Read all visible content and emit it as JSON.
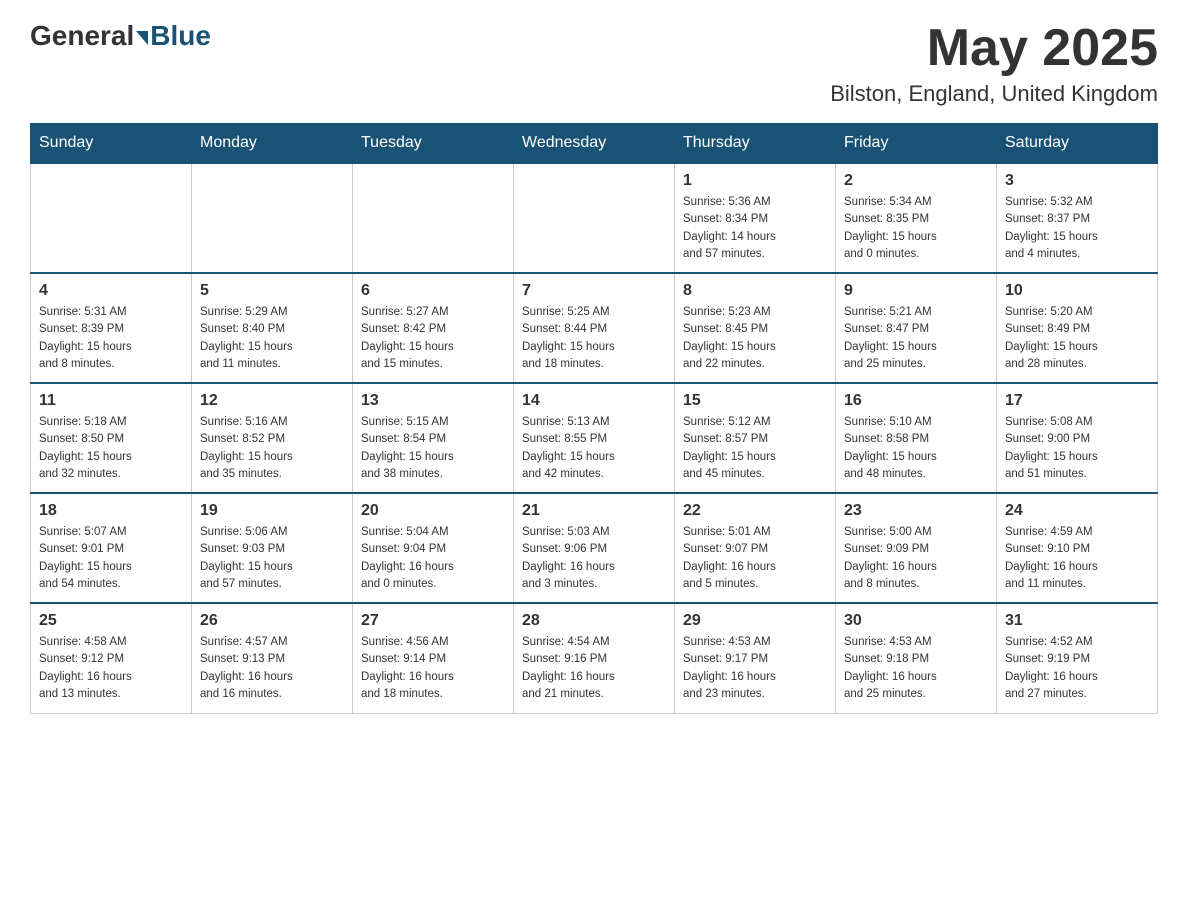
{
  "header": {
    "logo_general": "General",
    "logo_blue": "Blue",
    "month_year": "May 2025",
    "location": "Bilston, England, United Kingdom"
  },
  "days_of_week": [
    "Sunday",
    "Monday",
    "Tuesday",
    "Wednesday",
    "Thursday",
    "Friday",
    "Saturday"
  ],
  "weeks": [
    [
      {
        "day": "",
        "info": ""
      },
      {
        "day": "",
        "info": ""
      },
      {
        "day": "",
        "info": ""
      },
      {
        "day": "",
        "info": ""
      },
      {
        "day": "1",
        "info": "Sunrise: 5:36 AM\nSunset: 8:34 PM\nDaylight: 14 hours\nand 57 minutes."
      },
      {
        "day": "2",
        "info": "Sunrise: 5:34 AM\nSunset: 8:35 PM\nDaylight: 15 hours\nand 0 minutes."
      },
      {
        "day": "3",
        "info": "Sunrise: 5:32 AM\nSunset: 8:37 PM\nDaylight: 15 hours\nand 4 minutes."
      }
    ],
    [
      {
        "day": "4",
        "info": "Sunrise: 5:31 AM\nSunset: 8:39 PM\nDaylight: 15 hours\nand 8 minutes."
      },
      {
        "day": "5",
        "info": "Sunrise: 5:29 AM\nSunset: 8:40 PM\nDaylight: 15 hours\nand 11 minutes."
      },
      {
        "day": "6",
        "info": "Sunrise: 5:27 AM\nSunset: 8:42 PM\nDaylight: 15 hours\nand 15 minutes."
      },
      {
        "day": "7",
        "info": "Sunrise: 5:25 AM\nSunset: 8:44 PM\nDaylight: 15 hours\nand 18 minutes."
      },
      {
        "day": "8",
        "info": "Sunrise: 5:23 AM\nSunset: 8:45 PM\nDaylight: 15 hours\nand 22 minutes."
      },
      {
        "day": "9",
        "info": "Sunrise: 5:21 AM\nSunset: 8:47 PM\nDaylight: 15 hours\nand 25 minutes."
      },
      {
        "day": "10",
        "info": "Sunrise: 5:20 AM\nSunset: 8:49 PM\nDaylight: 15 hours\nand 28 minutes."
      }
    ],
    [
      {
        "day": "11",
        "info": "Sunrise: 5:18 AM\nSunset: 8:50 PM\nDaylight: 15 hours\nand 32 minutes."
      },
      {
        "day": "12",
        "info": "Sunrise: 5:16 AM\nSunset: 8:52 PM\nDaylight: 15 hours\nand 35 minutes."
      },
      {
        "day": "13",
        "info": "Sunrise: 5:15 AM\nSunset: 8:54 PM\nDaylight: 15 hours\nand 38 minutes."
      },
      {
        "day": "14",
        "info": "Sunrise: 5:13 AM\nSunset: 8:55 PM\nDaylight: 15 hours\nand 42 minutes."
      },
      {
        "day": "15",
        "info": "Sunrise: 5:12 AM\nSunset: 8:57 PM\nDaylight: 15 hours\nand 45 minutes."
      },
      {
        "day": "16",
        "info": "Sunrise: 5:10 AM\nSunset: 8:58 PM\nDaylight: 15 hours\nand 48 minutes."
      },
      {
        "day": "17",
        "info": "Sunrise: 5:08 AM\nSunset: 9:00 PM\nDaylight: 15 hours\nand 51 minutes."
      }
    ],
    [
      {
        "day": "18",
        "info": "Sunrise: 5:07 AM\nSunset: 9:01 PM\nDaylight: 15 hours\nand 54 minutes."
      },
      {
        "day": "19",
        "info": "Sunrise: 5:06 AM\nSunset: 9:03 PM\nDaylight: 15 hours\nand 57 minutes."
      },
      {
        "day": "20",
        "info": "Sunrise: 5:04 AM\nSunset: 9:04 PM\nDaylight: 16 hours\nand 0 minutes."
      },
      {
        "day": "21",
        "info": "Sunrise: 5:03 AM\nSunset: 9:06 PM\nDaylight: 16 hours\nand 3 minutes."
      },
      {
        "day": "22",
        "info": "Sunrise: 5:01 AM\nSunset: 9:07 PM\nDaylight: 16 hours\nand 5 minutes."
      },
      {
        "day": "23",
        "info": "Sunrise: 5:00 AM\nSunset: 9:09 PM\nDaylight: 16 hours\nand 8 minutes."
      },
      {
        "day": "24",
        "info": "Sunrise: 4:59 AM\nSunset: 9:10 PM\nDaylight: 16 hours\nand 11 minutes."
      }
    ],
    [
      {
        "day": "25",
        "info": "Sunrise: 4:58 AM\nSunset: 9:12 PM\nDaylight: 16 hours\nand 13 minutes."
      },
      {
        "day": "26",
        "info": "Sunrise: 4:57 AM\nSunset: 9:13 PM\nDaylight: 16 hours\nand 16 minutes."
      },
      {
        "day": "27",
        "info": "Sunrise: 4:56 AM\nSunset: 9:14 PM\nDaylight: 16 hours\nand 18 minutes."
      },
      {
        "day": "28",
        "info": "Sunrise: 4:54 AM\nSunset: 9:16 PM\nDaylight: 16 hours\nand 21 minutes."
      },
      {
        "day": "29",
        "info": "Sunrise: 4:53 AM\nSunset: 9:17 PM\nDaylight: 16 hours\nand 23 minutes."
      },
      {
        "day": "30",
        "info": "Sunrise: 4:53 AM\nSunset: 9:18 PM\nDaylight: 16 hours\nand 25 minutes."
      },
      {
        "day": "31",
        "info": "Sunrise: 4:52 AM\nSunset: 9:19 PM\nDaylight: 16 hours\nand 27 minutes."
      }
    ]
  ]
}
